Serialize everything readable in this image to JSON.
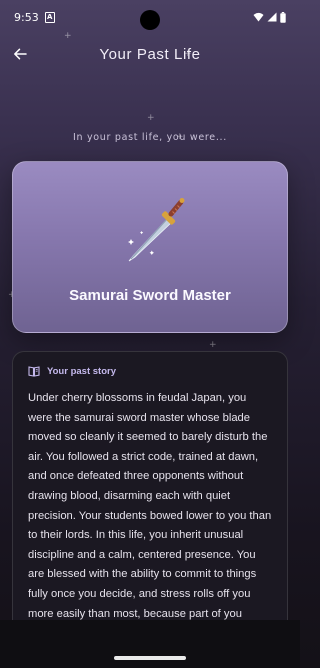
{
  "status_bar": {
    "time": "9:53",
    "sim_label": "A"
  },
  "header": {
    "title": "Your Past Life"
  },
  "subtitle": "In your past life, you were...",
  "hero": {
    "title": "Samurai Sword Master"
  },
  "story": {
    "header_label": "Your past story",
    "text": "Under cherry blossoms in feudal Japan, you were the samurai sword master whose blade moved so cleanly it seemed to barely disturb the air. You followed a strict code, trained at dawn, and once defeated three opponents without drawing blood, disarming each with quiet precision. Your students bowed lower to you than to their lords. In this life, you inherit unusual discipline and a calm, centered presence. You are blessed with the ability to commit to things fully once you decide, and stress rolls off you more easily than most, because part of you remembers standing still in"
  },
  "icons": {
    "back": "arrow-left-icon",
    "wifi": "wifi-icon",
    "signal": "signal-icon",
    "battery": "battery-icon",
    "sword": "sword-icon",
    "book": "book-icon"
  },
  "colors": {
    "accent": "#c4b8ec",
    "card": "#8677ad"
  }
}
